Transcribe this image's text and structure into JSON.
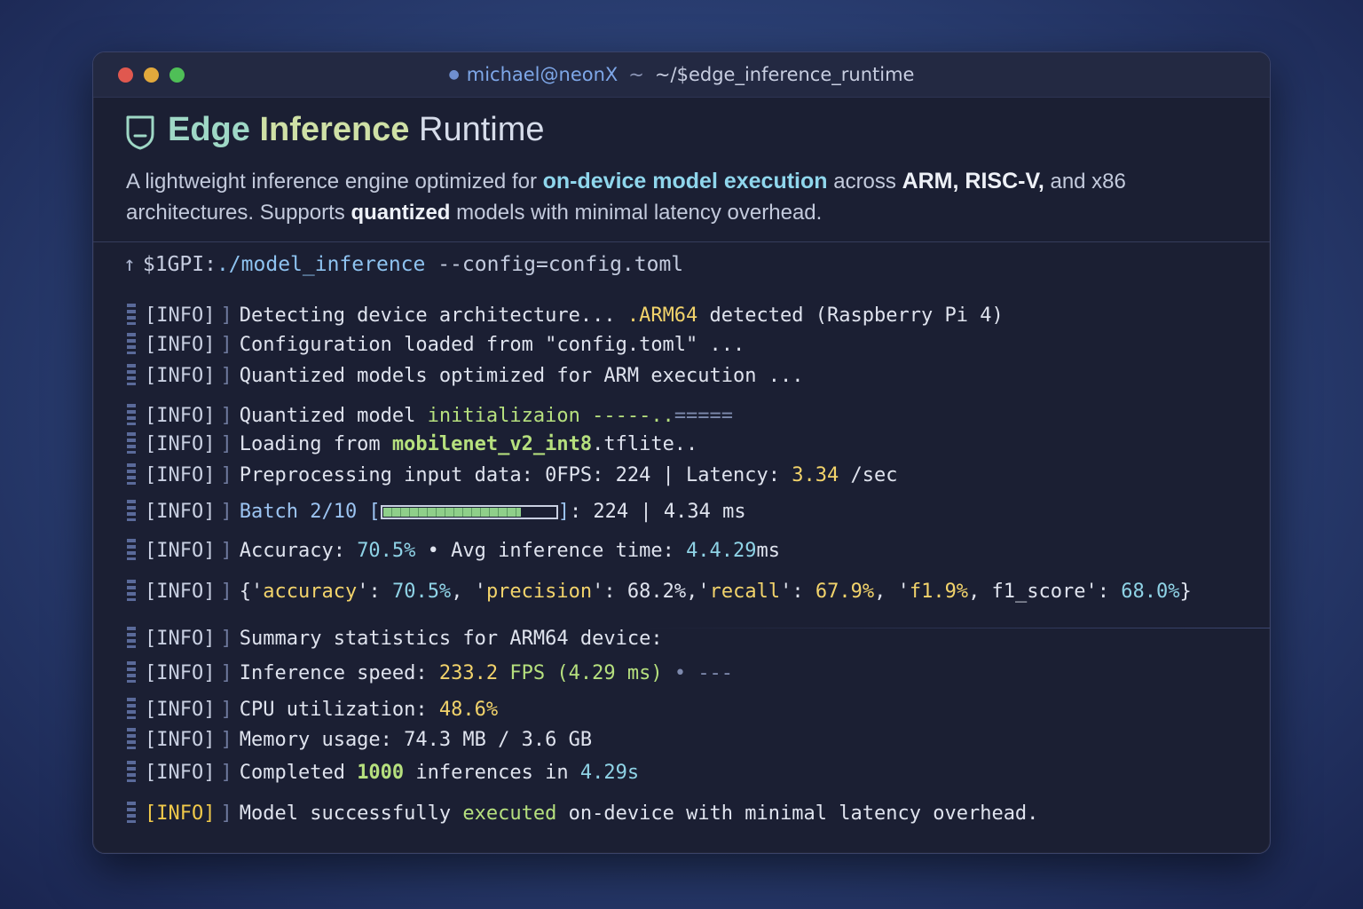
{
  "window": {
    "user_host": "michael@neonX",
    "tilde": "~",
    "path": "~/$edge_inference_runtime"
  },
  "header": {
    "title_word1": "Edge",
    "title_word2": "Inference",
    "title_word3": "Runtime",
    "desc_1": "A lightweight inference engine optimized for ",
    "desc_hl": "on-device model execution",
    "desc_2": " across ",
    "desc_arch": "ARM, RISC-V,",
    "desc_3": " and x86 architectures. Supports ",
    "desc_q": "quantized",
    "desc_4": " models with minimal latency overhead."
  },
  "prompt": {
    "prefix": "$1GPI:",
    "command": "./model_inference",
    "flag": " --config=config.toml"
  },
  "log": {
    "tag": "[INFO]",
    "bracket": "]",
    "l1a": "Detecting device architecture... ",
    "l1b": ".ARM64",
    "l1c": " detected (Raspberry Pi 4)",
    "l2": "Configuration loaded from \"config.toml\" ...",
    "l3": "Quantized models optimized for ARM execution ...",
    "l4a": "Quantized model ",
    "l4b": "initializaion",
    "l4c": " -----..",
    "l4d": "=====",
    "l5a": "Loading from ",
    "l5b": "mobilenet_v2_int8",
    "l5c": ".tflite..",
    "l6a": "Preprocessing input data: ",
    "l6b": "0FPS: 224 | Latency: ",
    "l6c": "3.34",
    "l6d": " /sec",
    "l7a": "Batch 2/10 [",
    "l7b": "]",
    "l7c": ": 224 | 4.34 ms",
    "batch_progress": 0.8,
    "l8a": "Accuracy: ",
    "l8b": "70.5%",
    "l8c": " • Avg inference time: ",
    "l8d": "4.4.29",
    "l8e": "ms",
    "l9a": "{'",
    "l9b": "accuracy",
    "l9c": "': ",
    "l9d": "70.5%",
    "l9e": ", '",
    "l9f": "precision",
    "l9g": "': 68.2%,'",
    "l9h": "recall",
    "l9i": "': ",
    "l9j": "67.9%",
    "l9k": ", '",
    "l9l": "f1.9%",
    "l9m": ", f1_score': ",
    "l9n": "68.0%",
    "l9o": "}",
    "l10": "Summary statistics for ARM64 device:",
    "l11a": "Inference speed: ",
    "l11b": "233.2",
    "l11c": " FPS (4.29 ms)",
    "l11d": " • ---",
    "l12a": "CPU utilization: ",
    "l12b": "48.6%",
    "l13": "Memory usage: 74.3 MB / 3.6 GB",
    "l14a": "Completed ",
    "l14b": "1000",
    "l14c": " inferences in ",
    "l14d": "4.29s",
    "l15a": "Model successfully ",
    "l15b": "executed",
    "l15c": " on-device with minimal latency overhead."
  },
  "colors": {
    "accent_green": "#b6e07e",
    "accent_yellow": "#f2d36b",
    "accent_cyan": "#8fd3e6"
  }
}
